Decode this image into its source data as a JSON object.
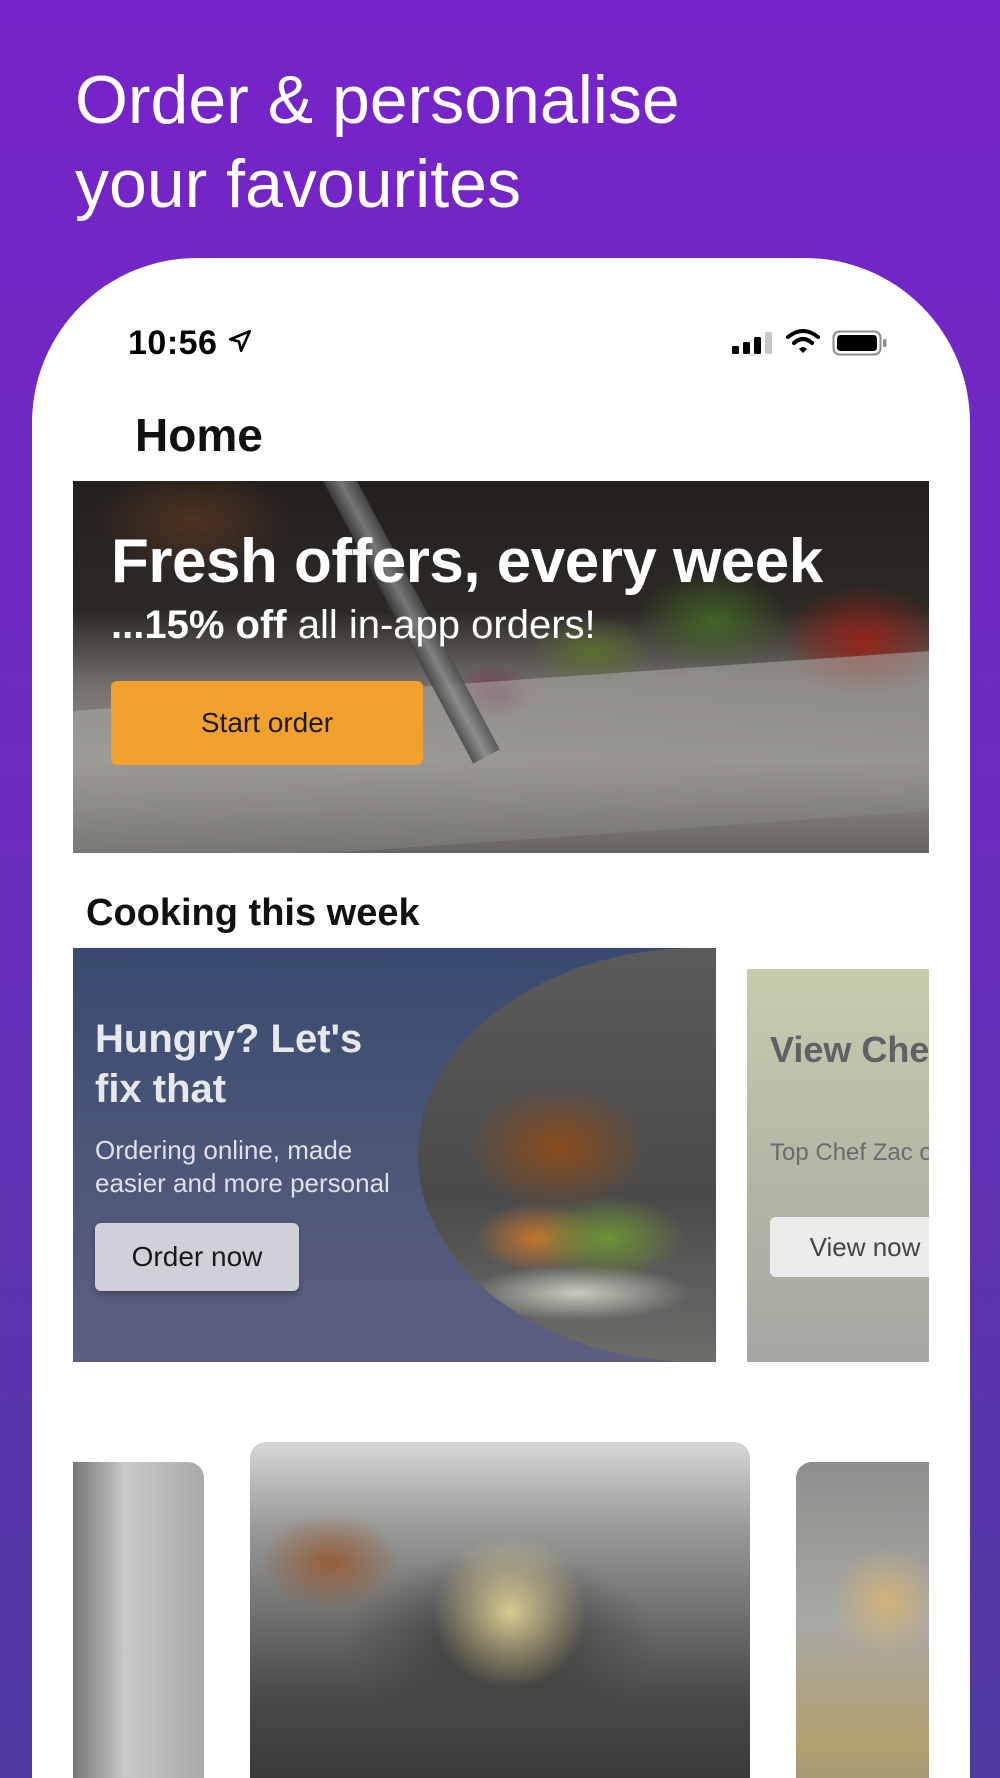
{
  "headline": {
    "line1": "Order & personalise",
    "line2": "your favourites"
  },
  "status_bar": {
    "time": "10:56",
    "icons": [
      "location-arrow-icon",
      "cellular-signal-icon",
      "wifi-icon",
      "battery-icon"
    ]
  },
  "page": {
    "title": "Home"
  },
  "hero": {
    "title": "Fresh offers, every week",
    "subtitle_bold": "...15% off",
    "subtitle_rest": " all in-app orders!",
    "button_label": "Start order",
    "button_color": "#f2a12f"
  },
  "section": {
    "title": "Cooking this week"
  },
  "cards": [
    {
      "title": "Hungry? Let's fix that",
      "body": "Ordering online, made easier and more personal",
      "button_label": "Order now"
    },
    {
      "title": "View Chef Specials",
      "body": "Top Chef Zac o range of favour",
      "button_label": "View now"
    }
  ],
  "colors": {
    "background_top": "#7623c9",
    "background_bottom": "#4e3aa0",
    "phone_surface": "#ffffff"
  }
}
